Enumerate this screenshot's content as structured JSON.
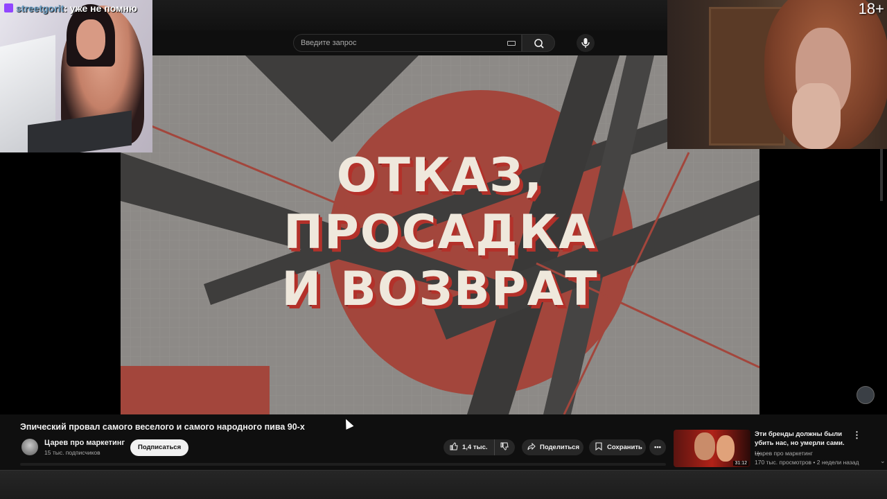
{
  "search": {
    "placeholder": "Введите запрос"
  },
  "video": {
    "overlay_lines": [
      "ОТКАЗ,",
      "ПРОСАДКА",
      "И ВОЗВРАТ"
    ]
  },
  "overlays": {
    "chat": {
      "username": "streetgorit",
      "message": ": уже не помню"
    },
    "age_badge": "18+"
  },
  "info": {
    "title": "Эпический провал самого веселого и самого народного пива 90-х",
    "channel": "Царев про маркетинг",
    "subscribers": "15 тыс. подписчиков",
    "subscribe_label": "Подписаться",
    "likes": "1,4 тыс.",
    "share_label": "Поделиться",
    "save_label": "Сохранить",
    "more_label": "•••"
  },
  "recommended": {
    "title": "Эти бренды должны были убить нас, но умерли сами. ...",
    "channel": "Царев про маркетинг",
    "meta": "170 тыс. просмотров • 2 недели назад",
    "duration": "31:12"
  },
  "icons": {
    "search": "search-icon",
    "mic": "mic-icon",
    "keyboard": "keyboard-icon",
    "like": "thumbs-up-icon",
    "dislike": "thumbs-down-icon",
    "share": "share-icon",
    "save": "save-icon",
    "twitch": "twitch-icon"
  },
  "colors": {
    "accent_red": "#b3312a",
    "background": "#0f0f0f",
    "twitch": "#9146ff"
  }
}
